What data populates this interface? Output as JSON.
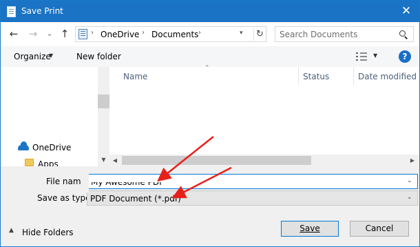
{
  "window": {
    "title": "Save Print",
    "close_glyph": "✕"
  },
  "nav": {
    "back_glyph": "←",
    "forward_glyph": "→",
    "recent_glyph": "⌄",
    "up_glyph": "↑",
    "breadcrumb": [
      "OneDrive",
      "Documents"
    ],
    "breadcrumb_sep": "›",
    "refresh_glyph": "↻",
    "search_placeholder": "Search Documents"
  },
  "commandbar": {
    "organize_label": "Organize",
    "new_folder_label": "New folder",
    "help_glyph": "?"
  },
  "navpane": {
    "items": [
      {
        "label": "OneDrive",
        "icon": "onedrive-cloud-icon"
      },
      {
        "label": "Apps",
        "icon": "folder-icon"
      }
    ]
  },
  "columns": [
    "Name",
    "Status",
    "Date modified"
  ],
  "form": {
    "file_name_label": "File name:",
    "file_name_value": "My Awesome PDF",
    "save_as_type_label": "Save as type:",
    "save_as_type_value": "PDF Document (*.pdf)"
  },
  "footer": {
    "hide_folders_label": "Hide Folders",
    "save_label": "Save",
    "cancel_label": "Cancel"
  },
  "colors": {
    "titlebar": "#1a73c4",
    "annotation_arrow": "#e8201a",
    "focus_border": "#0078d7"
  }
}
